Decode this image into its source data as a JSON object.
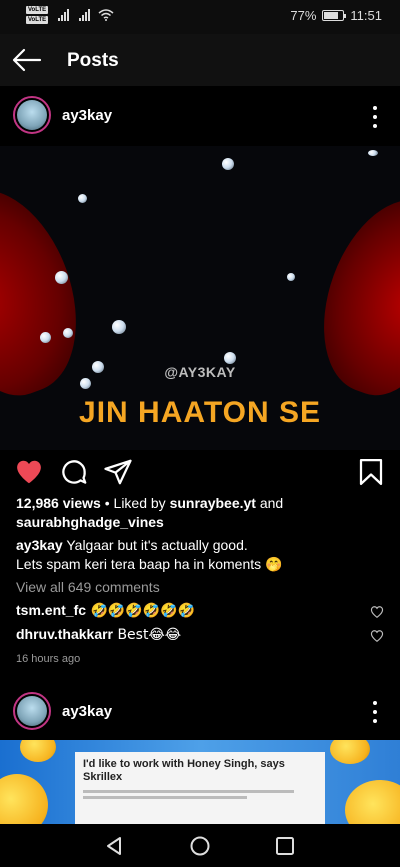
{
  "status_bar": {
    "volte_1": "VoLTE",
    "volte_2": "VoLTE",
    "battery_text": "77%",
    "battery_level": 0.77,
    "time": "11:51"
  },
  "app_bar": {
    "back_icon": "arrow-left-icon",
    "title": "Posts"
  },
  "post1": {
    "username": "ay3kay",
    "media": {
      "watermark": "@AY3KAY",
      "title_text": "JIN HAATON SE"
    },
    "views": "12,986 views",
    "liked_by_prefix": " • Liked by ",
    "liked_by_user1": "sunraybee.yt",
    "liked_by_and": " and",
    "liked_by_user2": "saurabhghadge_vines",
    "caption_user": "ay3kay",
    "caption_text": " Yalgaar but it's actually good.",
    "caption_text2": " Lets spam keri tera baap ha in koments ",
    "caption_emoji": "🤭",
    "view_all_comments": "View all 649 comments",
    "comments": [
      {
        "user": "tsm.ent_fc",
        "text": " 🤣🤣🤣🤣🤣🤣"
      },
      {
        "user": "dhruv.thakkarr",
        "text": " Best😂😂"
      }
    ],
    "timestamp": "16 hours ago"
  },
  "post2": {
    "username": "ay3kay",
    "news_headline": "I'd like to work with Honey Singh, says Skrillex"
  },
  "icons": {
    "like": "heart-filled-icon",
    "comment": "comment-icon",
    "share": "send-icon",
    "save": "bookmark-icon",
    "more": "more-vertical-icon",
    "comment_like": "heart-outline-icon"
  },
  "colors": {
    "like_red": "#ed4956",
    "title_orange": "#f5a623",
    "muted_text": "#9a9a9a"
  }
}
